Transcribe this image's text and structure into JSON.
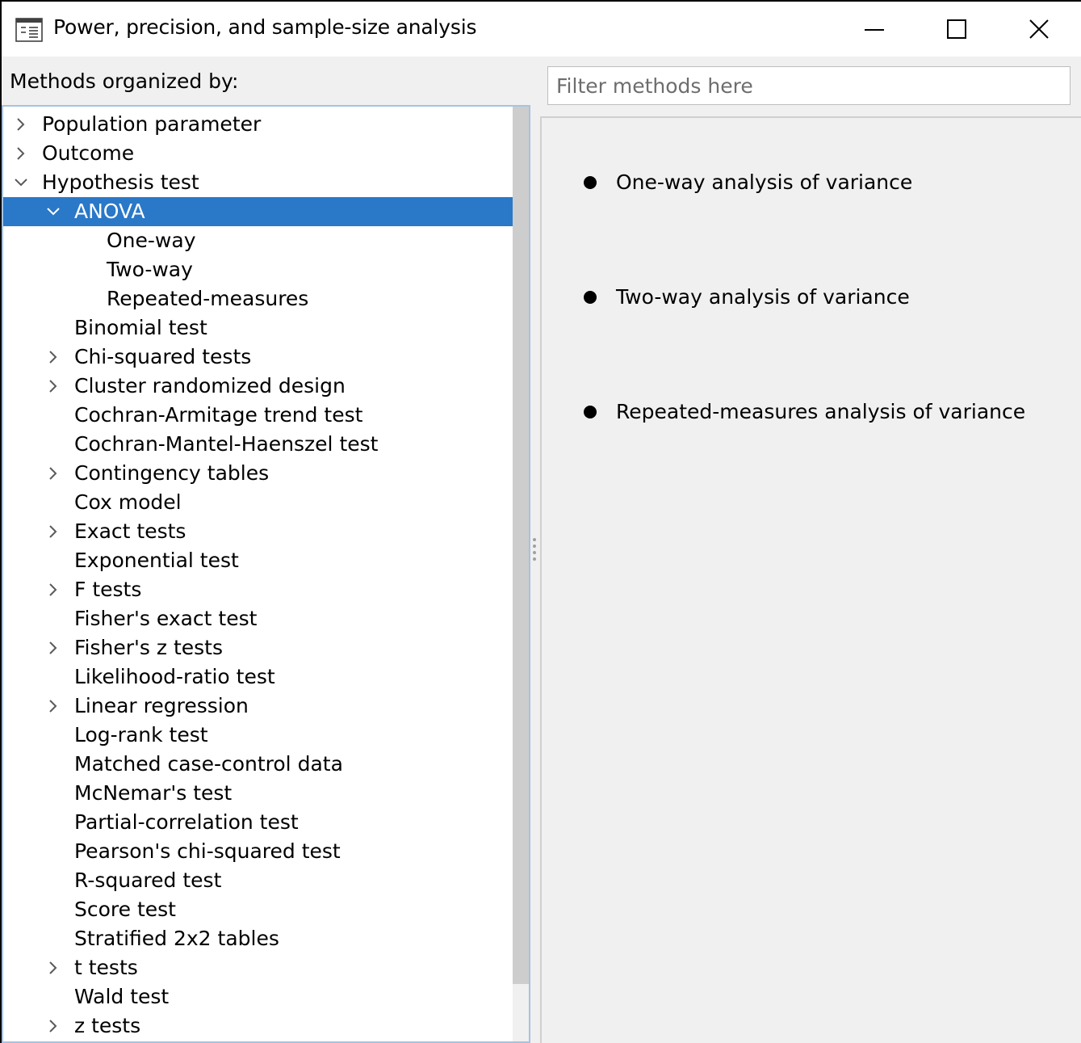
{
  "window": {
    "title": "Power, precision, and sample-size analysis"
  },
  "left": {
    "methods_label": "Methods organized by:"
  },
  "filter": {
    "placeholder": "Filter methods here",
    "value": ""
  },
  "tree": [
    {
      "label": "Population parameter",
      "level": 0,
      "chevron": "right",
      "selected": false
    },
    {
      "label": "Outcome",
      "level": 0,
      "chevron": "right",
      "selected": false
    },
    {
      "label": "Hypothesis test",
      "level": 0,
      "chevron": "down",
      "selected": false
    },
    {
      "label": "ANOVA",
      "level": 1,
      "chevron": "down",
      "selected": true
    },
    {
      "label": "One-way",
      "level": 2,
      "chevron": "none",
      "selected": false
    },
    {
      "label": "Two-way",
      "level": 2,
      "chevron": "none",
      "selected": false
    },
    {
      "label": "Repeated-measures",
      "level": 2,
      "chevron": "none",
      "selected": false
    },
    {
      "label": "Binomial test",
      "level": 1,
      "chevron": "none",
      "selected": false
    },
    {
      "label": "Chi-squared tests",
      "level": 1,
      "chevron": "right",
      "selected": false
    },
    {
      "label": "Cluster randomized design",
      "level": 1,
      "chevron": "right",
      "selected": false
    },
    {
      "label": "Cochran-Armitage trend test",
      "level": 1,
      "chevron": "none",
      "selected": false
    },
    {
      "label": "Cochran-Mantel-Haenszel test",
      "level": 1,
      "chevron": "none",
      "selected": false
    },
    {
      "label": "Contingency tables",
      "level": 1,
      "chevron": "right",
      "selected": false
    },
    {
      "label": "Cox model",
      "level": 1,
      "chevron": "none",
      "selected": false
    },
    {
      "label": "Exact tests",
      "level": 1,
      "chevron": "right",
      "selected": false
    },
    {
      "label": "Exponential test",
      "level": 1,
      "chevron": "none",
      "selected": false
    },
    {
      "label": "F tests",
      "level": 1,
      "chevron": "right",
      "selected": false
    },
    {
      "label": "Fisher's exact test",
      "level": 1,
      "chevron": "none",
      "selected": false
    },
    {
      "label": "Fisher's z tests",
      "level": 1,
      "chevron": "right",
      "selected": false
    },
    {
      "label": "Likelihood-ratio test",
      "level": 1,
      "chevron": "none",
      "selected": false
    },
    {
      "label": "Linear regression",
      "level": 1,
      "chevron": "right",
      "selected": false
    },
    {
      "label": "Log-rank test",
      "level": 1,
      "chevron": "none",
      "selected": false
    },
    {
      "label": "Matched case-control data",
      "level": 1,
      "chevron": "none",
      "selected": false
    },
    {
      "label": "McNemar's test",
      "level": 1,
      "chevron": "none",
      "selected": false
    },
    {
      "label": "Partial-correlation test",
      "level": 1,
      "chevron": "none",
      "selected": false
    },
    {
      "label": "Pearson's chi-squared test",
      "level": 1,
      "chevron": "none",
      "selected": false
    },
    {
      "label": "R-squared test",
      "level": 1,
      "chevron": "none",
      "selected": false
    },
    {
      "label": "Score test",
      "level": 1,
      "chevron": "none",
      "selected": false
    },
    {
      "label": "Stratified 2x2 tables",
      "level": 1,
      "chevron": "none",
      "selected": false
    },
    {
      "label": "t tests",
      "level": 1,
      "chevron": "right",
      "selected": false
    },
    {
      "label": "Wald test",
      "level": 1,
      "chevron": "none",
      "selected": false
    },
    {
      "label": "z tests",
      "level": 1,
      "chevron": "right",
      "selected": false
    }
  ],
  "right": {
    "items": [
      {
        "label": "One-way analysis of variance"
      },
      {
        "label": "Two-way analysis of variance"
      },
      {
        "label": "Repeated-measures analysis of variance"
      }
    ]
  },
  "colors": {
    "selection": "#2a78c8",
    "panel_background": "#f0f0f0",
    "tree_border": "#a8c2e0"
  }
}
